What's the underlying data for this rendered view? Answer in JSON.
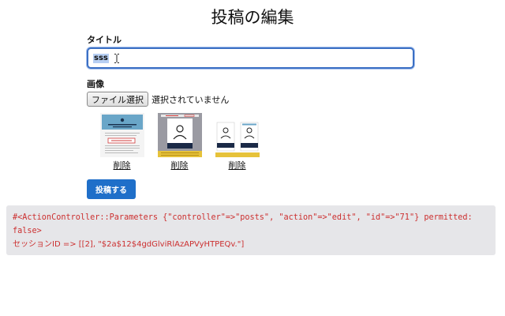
{
  "page": {
    "title": "投稿の編集"
  },
  "form": {
    "title_label": "タイトル",
    "title_value": "sss",
    "image_label": "画像",
    "file_button_label": "ファイル選択",
    "file_status": "選択されていません",
    "submit_label": "投稿する"
  },
  "images": [
    {
      "delete_label": "削除",
      "thumbnail_icon": "screenshot-signup-page-thumbnail"
    },
    {
      "delete_label": "削除",
      "thumbnail_icon": "screenshot-profile-page-thumbnail"
    },
    {
      "delete_label": "削除",
      "thumbnail_icon": "screenshot-profile-cards-thumbnail"
    }
  ],
  "debug": {
    "params_line1": "#<ActionController::Parameters {\"controller\"=>\"posts\", \"action\"=>\"edit\", \"id\"=>\"71\"} permitted:",
    "params_line2": "false>",
    "session_line": "セッションID => [[2], \"$2a$12$4gdGlviRlAzAPVyHTPEQv.\"]",
    "text_color": "#cc2f2f"
  },
  "colors": {
    "accent": "#1f6fc9",
    "input_focus_border": "#3b6fc4",
    "debug_background": "#e6e6e9"
  }
}
